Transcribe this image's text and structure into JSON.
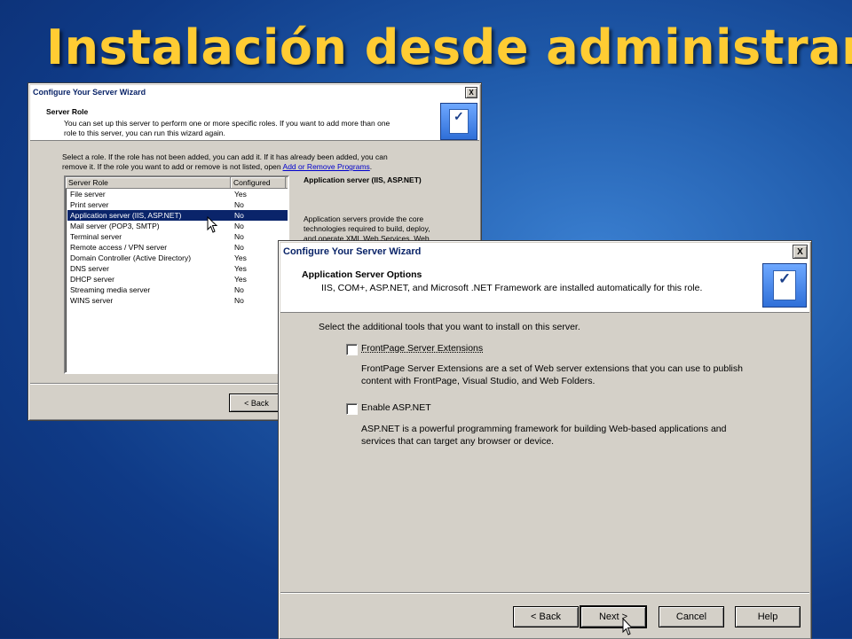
{
  "slide": {
    "title": "Instalación desde administrar"
  },
  "back_window": {
    "title": "Configure Your Server Wizard",
    "close_label": "X",
    "header_title": "Server Role",
    "header_desc_1": "You can set up this server to perform one or more specific roles. If you want to add more than one",
    "header_desc_2": "role to this server, you can run this wizard again.",
    "instr_1": "Select a role. If the role has not been added, you can add it. If it has already been added, you can",
    "instr_2_pre": "remove it. If the role you want to add or remove is not listed, open ",
    "instr_link": "Add or Remove Programs",
    "instr_2_post": ".",
    "columns": [
      "Server Role",
      "Configured"
    ],
    "roles": [
      {
        "name": "File server",
        "configured": "Yes"
      },
      {
        "name": "Print server",
        "configured": "No"
      },
      {
        "name": "Application server (IIS, ASP.NET)",
        "configured": "No"
      },
      {
        "name": "Mail server (POP3, SMTP)",
        "configured": "No"
      },
      {
        "name": "Terminal server",
        "configured": "No"
      },
      {
        "name": "Remote access / VPN server",
        "configured": "No"
      },
      {
        "name": "Domain Controller (Active Directory)",
        "configured": "Yes"
      },
      {
        "name": "DNS server",
        "configured": "Yes"
      },
      {
        "name": "DHCP server",
        "configured": "Yes"
      },
      {
        "name": "Streaming media server",
        "configured": "No"
      },
      {
        "name": "WINS server",
        "configured": "No"
      }
    ],
    "selected_role_index": 2,
    "detail_title": "Application server (IIS, ASP.NET)",
    "detail_desc_1": "Application servers provide the core",
    "detail_desc_2": "technologies required to build, deploy,",
    "detail_desc_3": "and operate XML Web Services, Web",
    "back_button": "< Back"
  },
  "front_window": {
    "title": "Configure Your Server Wizard",
    "close_label": "X",
    "header_title": "Application Server Options",
    "header_desc": "IIS, COM+, ASP.NET, and Microsoft .NET Framework are installed automatically for this role.",
    "instruction": "Select the additional tools that you want to install on this server.",
    "options": [
      {
        "label": "FrontPage Server Extensions",
        "checked": false,
        "desc_1": "FrontPage Server Extensions are a set of Web server extensions that you can use to publish",
        "desc_2": "content with FrontPage, Visual Studio, and Web Folders."
      },
      {
        "label": "Enable ASP.NET",
        "checked": false,
        "desc_1": "ASP.NET is a powerful programming framework for building Web-based applications and",
        "desc_2": "services that can target any browser or device."
      }
    ],
    "buttons": {
      "back": "< Back",
      "next": "Next >",
      "cancel": "Cancel",
      "help": "Help"
    }
  },
  "colors": {
    "title_yellow": "#ffcc33",
    "titlebar_text": "#0a2468",
    "selection": "#0a246a",
    "window_face": "#d4d0c8"
  }
}
